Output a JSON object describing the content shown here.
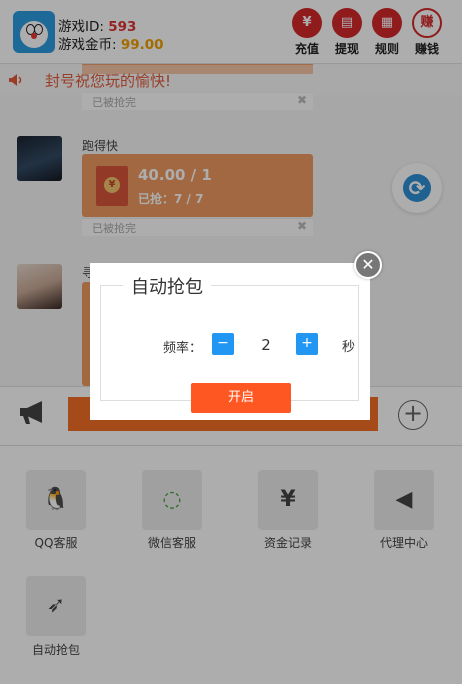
{
  "header": {
    "id_label": "游戏ID:",
    "id_value": "593",
    "gold_label": "游戏金币:",
    "gold_value": "99.00",
    "buttons": [
      {
        "label": "充值",
        "icon": "recharge-icon",
        "glyph": "¥"
      },
      {
        "label": "提现",
        "icon": "withdraw-icon",
        "glyph": "▤"
      },
      {
        "label": "规则",
        "icon": "gift-icon",
        "glyph": "▦"
      },
      {
        "label": "赚钱",
        "icon": "earn-icon",
        "glyph": "赚"
      }
    ]
  },
  "marquee": {
    "text": "封号祝您玩的愉快!"
  },
  "chat": {
    "grabbed_text": "已被抢完",
    "messages": [
      {
        "name": "跑得快",
        "amount": "40.00 / 1",
        "grabbed": "已抢：7 / 7"
      },
      {
        "name": "寻"
      }
    ]
  },
  "grid": {
    "items": [
      {
        "label": "QQ客服",
        "icon": "qq-icon",
        "glyph": "🐧"
      },
      {
        "label": "微信客服",
        "icon": "wechat-icon",
        "glyph": "◌"
      },
      {
        "label": "资金记录",
        "icon": "fund-record-icon",
        "glyph": "¥"
      },
      {
        "label": "代理中心",
        "icon": "agent-speaker-icon",
        "glyph": "◀"
      },
      {
        "label": "自动抢包",
        "icon": "rocket-icon",
        "glyph": "➶"
      }
    ]
  },
  "modal": {
    "title": "自动抢包",
    "freq_label": "频率：",
    "minus": "−",
    "plus": "+",
    "freq_value": "2",
    "unit": "秒",
    "start": "开启",
    "close": "✕"
  },
  "colors": {
    "accent_red": "#d4282c",
    "bubble_orange": "#ef9a62",
    "send_orange": "#f46e25",
    "stepper_blue": "#2196f3",
    "start_orange": "#ff5722"
  }
}
